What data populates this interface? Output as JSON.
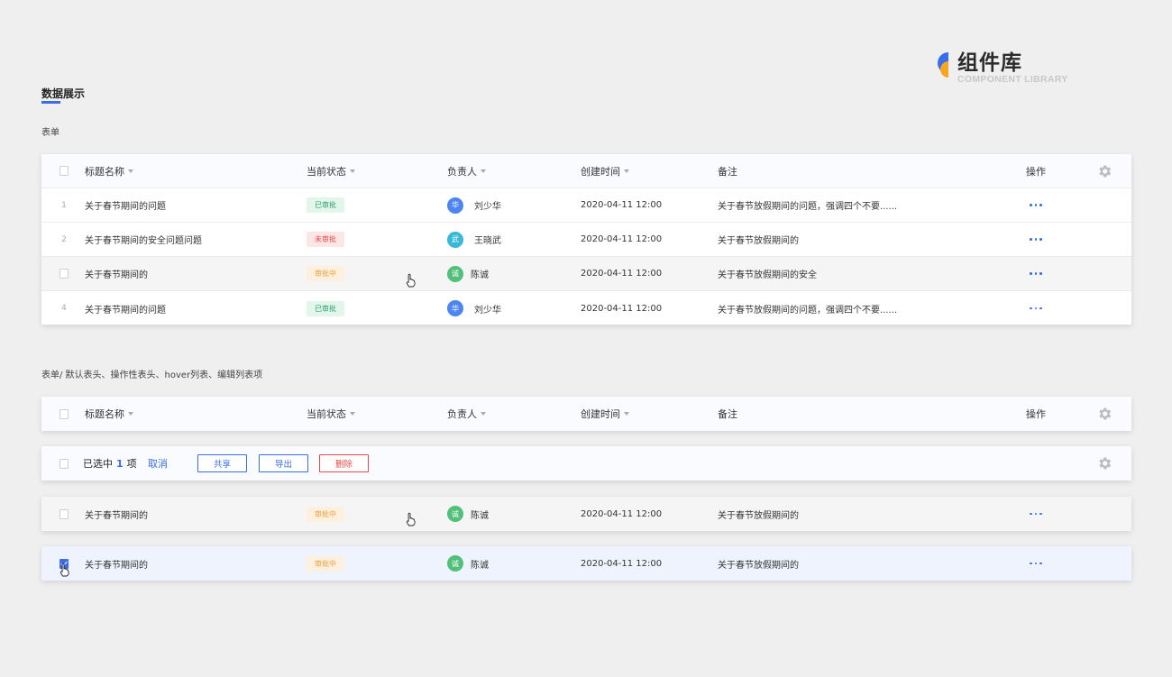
{
  "brand": {
    "title": "组件库",
    "subtitle": "COMPONENT LIBRARY",
    "colors": {
      "blue": "#3a6ee8",
      "orange": "#f5a623"
    }
  },
  "section": {
    "title": "数据展示"
  },
  "table1": {
    "label": "表单",
    "headers": {
      "title": "标题名称",
      "status": "当前状态",
      "owner": "负责人",
      "time": "创建时间",
      "note": "备注",
      "op": "操作"
    },
    "rows": [
      {
        "idx": "1",
        "title": "关于春节期间的问题",
        "status": "已审批",
        "avatar": "华",
        "owner": "刘少华",
        "time": "2020-04-11  12:00",
        "note": "关于春节放假期间的问题，强调四个不要......"
      },
      {
        "idx": "2",
        "title": "关于春节期间的安全问题问题",
        "status": "未审批",
        "avatar": "武",
        "owner": "王晓武",
        "time": "2020-04-11  12:00",
        "note": "关于春节放假期间的"
      },
      {
        "idx": "",
        "title": "关于春节期间的",
        "status": "审批中",
        "avatar": "诚",
        "owner": "陈诚",
        "time": "2020-04-11  12:00",
        "note": "关于春节放假期间的安全"
      },
      {
        "idx": "4",
        "title": "关于春节期间的问题",
        "status": "已审批",
        "avatar": "华",
        "owner": "刘少华",
        "time": "2020-04-11  12:00",
        "note": "关于春节放假期间的问题，强调四个不要......"
      }
    ]
  },
  "table2": {
    "label": "表单/ 默认表头、操作性表头、hover列表、编辑列表项",
    "headers": {
      "title": "标题名称",
      "status": "当前状态",
      "owner": "负责人",
      "time": "创建时间",
      "note": "备注",
      "op": "操作"
    },
    "bulk": {
      "prefix": "已选中",
      "count": "1",
      "suffix": "项",
      "cancel": "取消",
      "share": "共享",
      "export": "导出",
      "delete": "删除"
    },
    "hover_row": {
      "title": "关于春节期间的",
      "status": "审批中",
      "avatar": "诚",
      "owner": "陈诚",
      "time": "2020-04-11  12:00",
      "note": "关于春节放假期间的"
    },
    "selected_row": {
      "title": "关于春节期间的",
      "status": "审批中",
      "avatar": "诚",
      "owner": "陈诚",
      "time": "2020-04-11  12:00",
      "note": "关于春节放假期间的"
    }
  },
  "status_colors": {
    "approved": "#2ba26a",
    "rejected": "#e64a4a",
    "pending": "#f0a040"
  },
  "avatar_colors": {
    "华": "#4d86f0",
    "武": "#39b8d8",
    "诚": "#52c07a"
  }
}
